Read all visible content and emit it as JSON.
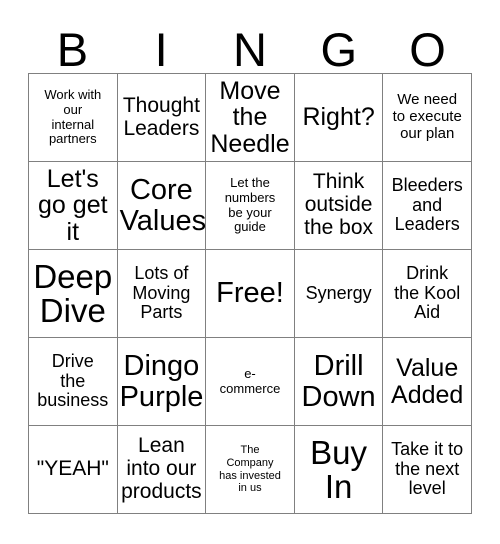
{
  "card": {
    "header_letters": [
      "B",
      "I",
      "N",
      "G",
      "O"
    ],
    "rows": [
      [
        {
          "text": "Work with\nour\ninternal\npartners",
          "size": "fs-s"
        },
        {
          "text": "Thought\nLeaders",
          "size": "fs-xl"
        },
        {
          "text": "Move\nthe\nNeedle",
          "size": "fs-2xl"
        },
        {
          "text": "Right?",
          "size": "fs-2xl"
        },
        {
          "text": "We need\nto execute\nour plan",
          "size": "fs-m"
        }
      ],
      [
        {
          "text": "Let's\ngo get\nit",
          "size": "fs-2xl"
        },
        {
          "text": "Core\nValues",
          "size": "fs-3xl"
        },
        {
          "text": "Let the\nnumbers\nbe your\nguide",
          "size": "fs-s"
        },
        {
          "text": "Think\noutside\nthe box",
          "size": "fs-xl"
        },
        {
          "text": "Bleeders\nand\nLeaders",
          "size": "fs-l"
        }
      ],
      [
        {
          "text": "Deep\nDive",
          "size": "fs-4xl"
        },
        {
          "text": "Lots of\nMoving\nParts",
          "size": "fs-l"
        },
        {
          "text": "Free!",
          "size": "fs-3xl"
        },
        {
          "text": "Synergy",
          "size": "fs-l"
        },
        {
          "text": "Drink\nthe Kool\nAid",
          "size": "fs-l"
        }
      ],
      [
        {
          "text": "Drive\nthe\nbusiness",
          "size": "fs-l"
        },
        {
          "text": "Dingo\nPurple",
          "size": "fs-3xl"
        },
        {
          "text": "e-\ncommerce",
          "size": "fs-s"
        },
        {
          "text": "Drill\nDown",
          "size": "fs-3xl"
        },
        {
          "text": "Value\nAdded",
          "size": "fs-2xl"
        }
      ],
      [
        {
          "text": "\"YEAH\"",
          "size": "fs-xl"
        },
        {
          "text": "Lean\ninto our\nproducts",
          "size": "fs-xl"
        },
        {
          "text": "The\nCompany\nhas invested\nin us",
          "size": "fs-xs"
        },
        {
          "text": "Buy\nIn",
          "size": "fs-4xl"
        },
        {
          "text": "Take it to\nthe next\nlevel",
          "size": "fs-l"
        }
      ]
    ]
  },
  "colors": {
    "background": "#ffffff",
    "text": "#000000",
    "grid_line": "#808080"
  }
}
